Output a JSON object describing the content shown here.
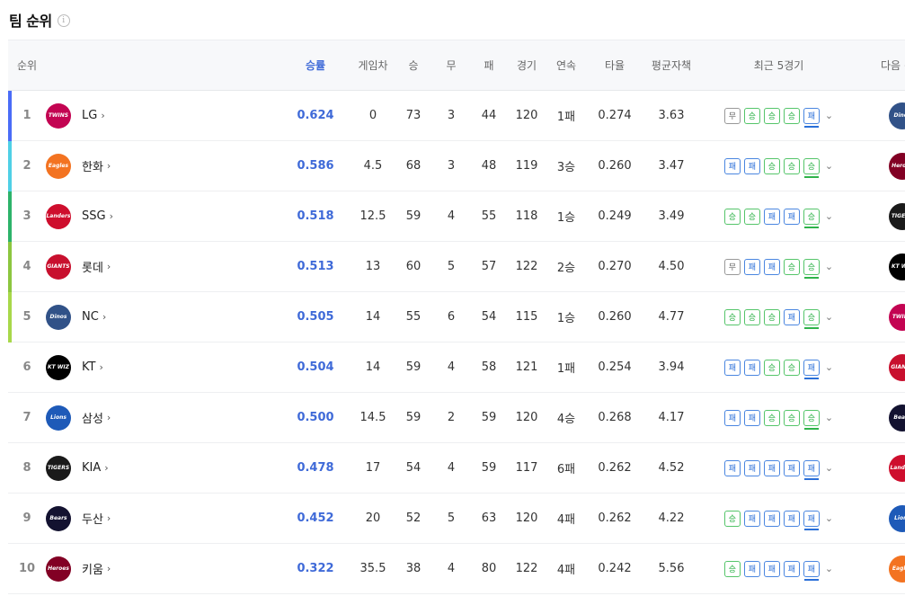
{
  "title": "팀 순위",
  "info_icon": "info-icon",
  "columns": {
    "rank": "순위",
    "pct": "승률",
    "gb": "게임차",
    "w": "승",
    "d": "무",
    "l": "패",
    "g": "경기",
    "streak": "연속",
    "avg": "타율",
    "era": "평균자책",
    "recent": "최근 5경기",
    "next": "다음 경기"
  },
  "rows": [
    {
      "rank": "1",
      "team": "LG",
      "logo_label": "TWINS",
      "logo_color": "#c30452",
      "bar": "#4a6cf7",
      "pct": "0.624",
      "gb": "0",
      "w": "73",
      "d": "3",
      "l": "44",
      "g": "120",
      "streak": "1패",
      "avg": "0.274",
      "era": "3.63",
      "recent": [
        "무",
        "승",
        "승",
        "승",
        "패"
      ],
      "next_label": "Dinos",
      "next_color": "#315288"
    },
    {
      "rank": "2",
      "team": "한화",
      "logo_label": "Eagles",
      "logo_color": "#f37321",
      "bar": "#4fd0e6",
      "pct": "0.586",
      "gb": "4.5",
      "w": "68",
      "d": "3",
      "l": "48",
      "g": "119",
      "streak": "3승",
      "avg": "0.260",
      "era": "3.47",
      "recent": [
        "패",
        "패",
        "승",
        "승",
        "승"
      ],
      "next_label": "Heroes",
      "next_color": "#820024"
    },
    {
      "rank": "3",
      "team": "SSG",
      "logo_label": "Landers",
      "logo_color": "#ce0e2d",
      "bar": "#2db36a",
      "pct": "0.518",
      "gb": "12.5",
      "w": "59",
      "d": "4",
      "l": "55",
      "g": "118",
      "streak": "1승",
      "avg": "0.249",
      "era": "3.49",
      "recent": [
        "승",
        "승",
        "패",
        "패",
        "승"
      ],
      "next_label": "TIGERS",
      "next_color": "#1a1a1a"
    },
    {
      "rank": "4",
      "team": "롯데",
      "logo_label": "GIANTS",
      "logo_color": "#c8102e",
      "bar": "#8cc63f",
      "pct": "0.513",
      "gb": "13",
      "w": "60",
      "d": "5",
      "l": "57",
      "g": "122",
      "streak": "2승",
      "avg": "0.270",
      "era": "4.50",
      "recent": [
        "무",
        "패",
        "패",
        "승",
        "승"
      ],
      "next_label": "KT WIZ",
      "next_color": "#000000"
    },
    {
      "rank": "5",
      "team": "NC",
      "logo_label": "Dinos",
      "logo_color": "#315288",
      "bar": "#a8d84a",
      "pct": "0.505",
      "gb": "14",
      "w": "55",
      "d": "6",
      "l": "54",
      "g": "115",
      "streak": "1승",
      "avg": "0.260",
      "era": "4.77",
      "recent": [
        "승",
        "승",
        "승",
        "패",
        "승"
      ],
      "next_label": "TWINS",
      "next_color": "#c30452"
    },
    {
      "rank": "6",
      "team": "KT",
      "logo_label": "KT WIZ",
      "logo_color": "#000000",
      "bar": "",
      "pct": "0.504",
      "gb": "14",
      "w": "59",
      "d": "4",
      "l": "58",
      "g": "121",
      "streak": "1패",
      "avg": "0.254",
      "era": "3.94",
      "recent": [
        "패",
        "패",
        "승",
        "승",
        "패"
      ],
      "next_label": "GIANTS",
      "next_color": "#c8102e"
    },
    {
      "rank": "7",
      "team": "삼성",
      "logo_label": "Lions",
      "logo_color": "#1e5ab8",
      "bar": "",
      "pct": "0.500",
      "gb": "14.5",
      "w": "59",
      "d": "2",
      "l": "59",
      "g": "120",
      "streak": "4승",
      "avg": "0.268",
      "era": "4.17",
      "recent": [
        "패",
        "패",
        "승",
        "승",
        "승"
      ],
      "next_label": "Bears",
      "next_color": "#131230"
    },
    {
      "rank": "8",
      "team": "KIA",
      "logo_label": "TIGERS",
      "logo_color": "#1a1a1a",
      "bar": "",
      "pct": "0.478",
      "gb": "17",
      "w": "54",
      "d": "4",
      "l": "59",
      "g": "117",
      "streak": "6패",
      "avg": "0.262",
      "era": "4.52",
      "recent": [
        "패",
        "패",
        "패",
        "패",
        "패"
      ],
      "next_label": "Landers",
      "next_color": "#ce0e2d"
    },
    {
      "rank": "9",
      "team": "두산",
      "logo_label": "Bears",
      "logo_color": "#131230",
      "bar": "",
      "pct": "0.452",
      "gb": "20",
      "w": "52",
      "d": "5",
      "l": "63",
      "g": "120",
      "streak": "4패",
      "avg": "0.262",
      "era": "4.22",
      "recent": [
        "승",
        "패",
        "패",
        "패",
        "패"
      ],
      "next_label": "Lions",
      "next_color": "#1e5ab8"
    },
    {
      "rank": "10",
      "team": "키움",
      "logo_label": "Heroes",
      "logo_color": "#820024",
      "bar": "",
      "pct": "0.322",
      "gb": "35.5",
      "w": "38",
      "d": "4",
      "l": "80",
      "g": "122",
      "streak": "4패",
      "avg": "0.242",
      "era": "5.56",
      "recent": [
        "승",
        "패",
        "패",
        "패",
        "패"
      ],
      "next_label": "Eagles",
      "next_color": "#f37321"
    }
  ]
}
